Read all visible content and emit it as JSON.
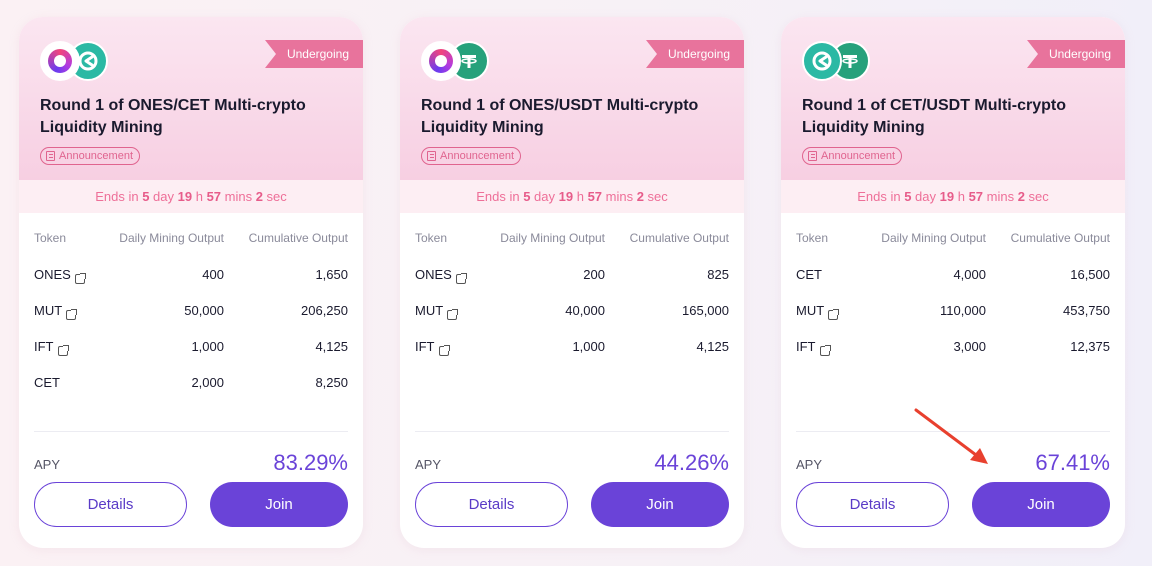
{
  "cards": [
    {
      "status": "Undergoing",
      "coins": [
        "ones-icon",
        "cet-icon"
      ],
      "title": "Round 1 of ONES/CET Multi-crypto Liquidity Mining",
      "announcement": "Announcement",
      "countdown": {
        "prefix": "Ends in ",
        "days": "5",
        "days_unit": " day ",
        "hours": "19",
        "hours_unit": " h ",
        "mins": "57",
        "mins_unit": " mins ",
        "secs": "2",
        "secs_unit": " sec"
      },
      "headers": {
        "token": "Token",
        "daily": "Daily Mining Output",
        "cumulative": "Cumulative Output"
      },
      "rows": [
        {
          "token": "ONES",
          "link": true,
          "daily": "400",
          "cumulative": "1,650"
        },
        {
          "token": "MUT",
          "link": true,
          "daily": "50,000",
          "cumulative": "206,250"
        },
        {
          "token": "IFT",
          "link": true,
          "daily": "1,000",
          "cumulative": "4,125"
        },
        {
          "token": "CET",
          "link": false,
          "daily": "2,000",
          "cumulative": "8,250"
        }
      ],
      "apy_label": "APY",
      "apy": "83.29%",
      "details_label": "Details",
      "join_label": "Join"
    },
    {
      "status": "Undergoing",
      "coins": [
        "ones-icon",
        "usdt-icon"
      ],
      "title": "Round 1 of ONES/USDT Multi-crypto Liquidity Mining",
      "announcement": "Announcement",
      "countdown": {
        "prefix": "Ends in ",
        "days": "5",
        "days_unit": " day ",
        "hours": "19",
        "hours_unit": " h ",
        "mins": "57",
        "mins_unit": " mins ",
        "secs": "2",
        "secs_unit": " sec"
      },
      "headers": {
        "token": "Token",
        "daily": "Daily Mining Output",
        "cumulative": "Cumulative Output"
      },
      "rows": [
        {
          "token": "ONES",
          "link": true,
          "daily": "200",
          "cumulative": "825"
        },
        {
          "token": "MUT",
          "link": true,
          "daily": "40,000",
          "cumulative": "165,000"
        },
        {
          "token": "IFT",
          "link": true,
          "daily": "1,000",
          "cumulative": "4,125"
        }
      ],
      "apy_label": "APY",
      "apy": "44.26%",
      "details_label": "Details",
      "join_label": "Join"
    },
    {
      "status": "Undergoing",
      "coins": [
        "cet-icon",
        "usdt-icon"
      ],
      "title": "Round 1 of CET/USDT Multi-crypto Liquidity Mining",
      "announcement": "Announcement",
      "countdown": {
        "prefix": "Ends in ",
        "days": "5",
        "days_unit": " day ",
        "hours": "19",
        "hours_unit": " h ",
        "mins": "57",
        "mins_unit": " mins ",
        "secs": "2",
        "secs_unit": " sec"
      },
      "headers": {
        "token": "Token",
        "daily": "Daily Mining Output",
        "cumulative": "Cumulative Output"
      },
      "rows": [
        {
          "token": "CET",
          "link": false,
          "daily": "4,000",
          "cumulative": "16,500"
        },
        {
          "token": "MUT",
          "link": true,
          "daily": "110,000",
          "cumulative": "453,750"
        },
        {
          "token": "IFT",
          "link": true,
          "daily": "3,000",
          "cumulative": "12,375"
        }
      ],
      "apy_label": "APY",
      "apy": "67.41%",
      "details_label": "Details",
      "join_label": "Join"
    }
  ],
  "colors": {
    "accent": "#6a43d8",
    "badge": "#e8739c",
    "countdown": "#ee6f98",
    "annotation_arrow": "#e8402e"
  }
}
